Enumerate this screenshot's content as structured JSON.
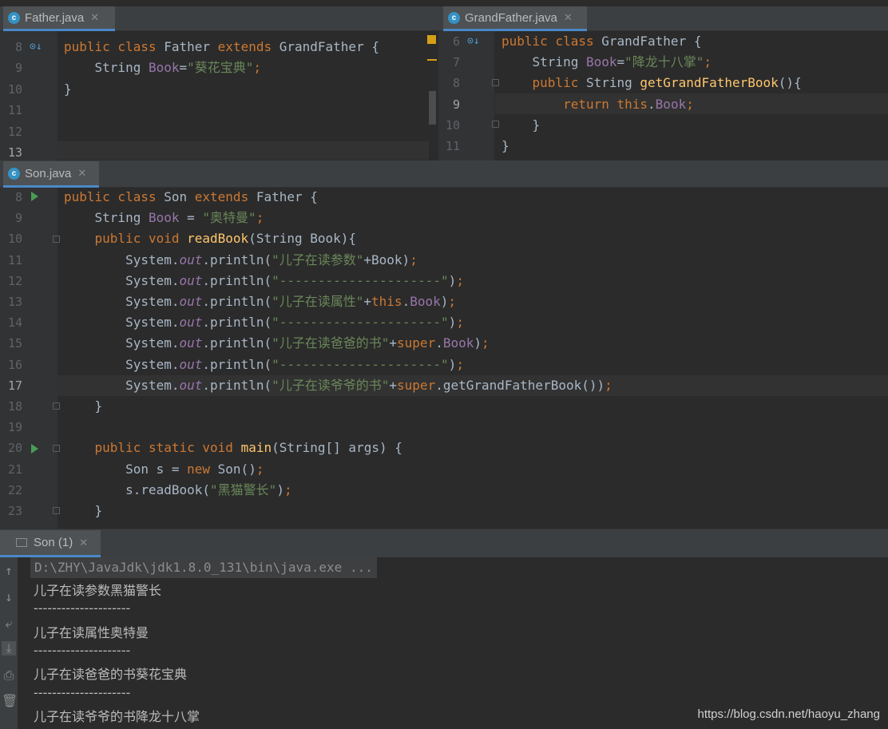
{
  "tabs": {
    "father": "Father.java",
    "grandfather": "GrandFather.java",
    "son": "Son.java"
  },
  "father_editor": {
    "lines": [
      {
        "n": "8",
        "html": "<span class=\"kw\">public class </span>Father <span class=\"kw\">extends </span>GrandFather {"
      },
      {
        "n": "9",
        "html": "    String <span class=\"fld\">Book</span>=<span class=\"str\">\"葵花宝典\"</span><span class=\"kw\">;</span>"
      },
      {
        "n": "10",
        "html": "}"
      },
      {
        "n": "11",
        "html": ""
      },
      {
        "n": "12",
        "html": ""
      },
      {
        "n": "13",
        "html": ""
      }
    ]
  },
  "grandfather_editor": {
    "lines": [
      {
        "n": "6",
        "html": "<span class=\"kw\">public class </span>GrandFather {"
      },
      {
        "n": "7",
        "html": "    String <span class=\"fld\">Book</span>=<span class=\"str\">\"降龙十八掌\"</span><span class=\"kw\">;</span>"
      },
      {
        "n": "8",
        "html": "    <span class=\"kw\">public </span>String <span class=\"fn\">getGrandFatherBook</span>(){"
      },
      {
        "n": "9",
        "html": "        <span class=\"kw\">return this</span>.<span class=\"fld\">Book</span><span class=\"kw\">;</span>"
      },
      {
        "n": "10",
        "html": "    }"
      },
      {
        "n": "11",
        "html": "}"
      }
    ]
  },
  "son_editor": {
    "lines": [
      {
        "n": "8",
        "html": "<span class=\"kw\">public class </span>Son <span class=\"kw\">extends </span>Father {"
      },
      {
        "n": "9",
        "html": "    String <span class=\"fld\">Book </span>= <span class=\"str\">\"奥特曼\"</span><span class=\"kw\">;</span>"
      },
      {
        "n": "10",
        "html": "    <span class=\"kw\">public void </span><span class=\"fn\">readBook</span>(String Book){"
      },
      {
        "n": "11",
        "html": "        System.<span class=\"sfld\">out</span>.println(<span class=\"str\">\"儿子在读参数\"</span>+Book)<span class=\"kw\">;</span>"
      },
      {
        "n": "12",
        "html": "        System.<span class=\"sfld\">out</span>.println(<span class=\"str\">\"---------------------\"</span>)<span class=\"kw\">;</span>"
      },
      {
        "n": "13",
        "html": "        System.<span class=\"sfld\">out</span>.println(<span class=\"str\">\"儿子在读属性\"</span>+<span class=\"kw\">this</span>.<span class=\"fld\">Book</span>)<span class=\"kw\">;</span>"
      },
      {
        "n": "14",
        "html": "        System.<span class=\"sfld\">out</span>.println(<span class=\"str\">\"---------------------\"</span>)<span class=\"kw\">;</span>"
      },
      {
        "n": "15",
        "html": "        System.<span class=\"sfld\">out</span>.println(<span class=\"str\">\"儿子在读爸爸的书\"</span>+<span class=\"kw\">super</span>.<span class=\"fld\">Book</span>)<span class=\"kw\">;</span>"
      },
      {
        "n": "16",
        "html": "        System.<span class=\"sfld\">out</span>.println(<span class=\"str\">\"---------------------\"</span>)<span class=\"kw\">;</span>"
      },
      {
        "n": "17",
        "html": "        System.<span class=\"sfld\">out</span>.println(<span class=\"str\">\"儿子在读爷爷的书\"</span>+<span class=\"kw\">super</span>.getGrandFatherBook())<span class=\"kw\">;</span>"
      },
      {
        "n": "18",
        "html": "    }"
      },
      {
        "n": "19",
        "html": ""
      },
      {
        "n": "20",
        "html": "    <span class=\"kw\">public static void </span><span class=\"fn\">main</span>(String[] args) {"
      },
      {
        "n": "21",
        "html": "        Son s = <span class=\"kw\">new </span>Son()<span class=\"kw\">;</span>"
      },
      {
        "n": "22",
        "html": "        s.readBook(<span class=\"str\">\"黑猫警长\"</span>)<span class=\"kw\">;</span>"
      },
      {
        "n": "23",
        "html": "    }"
      }
    ]
  },
  "run_panel": {
    "tab_label": "Son (1)",
    "command": "D:\\ZHY\\JavaJdk\\jdk1.8.0_131\\bin\\java.exe ...",
    "output": [
      "儿子在读参数黑猫警长",
      "---------------------",
      "儿子在读属性奥特曼",
      "---------------------",
      "儿子在读爸爸的书葵花宝典",
      "---------------------",
      "儿子在读爷爷的书降龙十八掌"
    ]
  },
  "watermark": "https://blog.csdn.net/haoyu_zhang"
}
